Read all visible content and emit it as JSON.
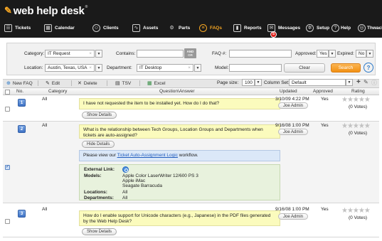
{
  "app": {
    "name": "web help desk",
    "trademark": "®"
  },
  "nav": {
    "tickets": "Tickets",
    "calendar": "Calendar",
    "clients": "Clients",
    "assets": "Assets",
    "parts": "Parts",
    "faqs": "FAQs",
    "reports": "Reports",
    "messages": "Messages",
    "messages_badge": "5",
    "setup": "Setup",
    "help": "Help",
    "thwack": "Thwack"
  },
  "search": {
    "category_label": "Category:",
    "category_value": "IT Request",
    "contains_label": "Contains:",
    "contains_value": "",
    "and_label": "AND",
    "or_label": "OR",
    "faq_label": "FAQ #:",
    "faq_value": "",
    "approved_label": "Approved:",
    "approved_value": "Yes",
    "expired_label": "Expired:",
    "expired_value": "No",
    "location_label": "Location:",
    "location_value": "Austin, Texas, USA",
    "department_label": "Department:",
    "department_value": "IT Desktop",
    "model_label": "Model:",
    "model_value": "",
    "clear_label": "Clear",
    "search_label": "Search",
    "help_glyph": "?"
  },
  "toolbar": {
    "new_faq": "New FAQ",
    "edit": "Edit",
    "delete": "Delete",
    "tsv": "TSV",
    "excel": "Excel",
    "page_size_label": "Page size:",
    "page_size_value": "100",
    "column_set_label": "Column Set:",
    "column_set_value": "Default"
  },
  "columns": {
    "no": "No.",
    "category": "Category",
    "question_answer": "Question\\Answer",
    "updated": "Updated",
    "approved": "Approved",
    "rating": "Rating"
  },
  "rows": [
    {
      "number": "1",
      "category": "All",
      "question": "I have not requested the item to be installed yet.  How do I do that?",
      "details_button": "Show Details",
      "updated": "3/10/09 4:22 PM",
      "owner": "Joe Admin",
      "approved": "Yes",
      "votes": "(0 Votes)"
    },
    {
      "number": "2",
      "category": "All",
      "question": "What is the relationship between Tech Groups, Location Groups and Departments when tickets are auto-assigned?",
      "details_button": "Hide Details",
      "answer_prefix": "Please view our ",
      "answer_link": "Ticket Auto-Assignment Logic",
      "answer_suffix": " workflow.",
      "ext_link_label": "External Link:",
      "models_label": "Models:",
      "models": [
        "Apple Color LaserWriter 12/600 PS 3",
        "Apple iMac",
        "Seagate Barracuda"
      ],
      "locations_label": "Locations:",
      "locations_value": "All",
      "departments_label": "Departments:",
      "departments_value": "All",
      "updated": "9/16/08 1:00 PM",
      "owner": "Joe Admin",
      "approved": "Yes",
      "votes": "(0 Votes)"
    },
    {
      "number": "3",
      "category": "All",
      "question": "How do I enable support for Unicode characters (e.g., Japanese) in the PDF files generated by the Web Help Desk?",
      "details_button": "Show Details",
      "updated": "9/16/08 1:00 PM",
      "owner": "Joe Admin",
      "approved": "Yes",
      "votes": "(0 Votes)"
    }
  ],
  "glyphs": {
    "clear_x": "×",
    "dropdown": "▼",
    "star_row": "★★★★★",
    "plus": "+",
    "wrench": "✎",
    "info": "ⓘ"
  },
  "colors": {
    "header_bg": "#1a1a1a",
    "accent": "#f5a623",
    "link": "#1f5bbd",
    "badge": "#e0201a"
  }
}
